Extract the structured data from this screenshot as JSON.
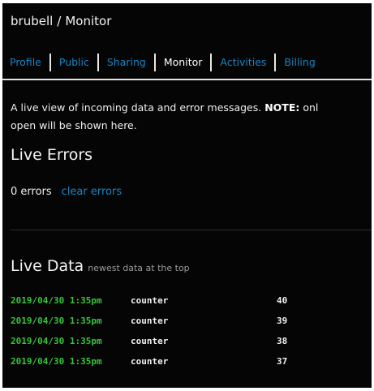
{
  "breadcrumb": {
    "user": "brubell",
    "separator": "/",
    "page": "Monitor"
  },
  "tabs": [
    {
      "label": "Profile",
      "active": false
    },
    {
      "label": "Public",
      "active": false
    },
    {
      "label": "Sharing",
      "active": false
    },
    {
      "label": "Monitor",
      "active": true
    },
    {
      "label": "Activities",
      "active": false
    },
    {
      "label": "Billing",
      "active": false
    }
  ],
  "description": {
    "text": "A live view of incoming data and error messages.",
    "note_label": "NOTE:",
    "note_text": "onl",
    "line2": "open will be shown here."
  },
  "errors": {
    "title": "Live Errors",
    "count_text": "0 errors",
    "clear_link": "clear errors"
  },
  "live_data": {
    "title": "Live Data",
    "subtitle": "newest data at the top",
    "rows": [
      {
        "timestamp": "2019/04/30 1:35pm",
        "feed": "counter",
        "value": "40"
      },
      {
        "timestamp": "2019/04/30 1:35pm",
        "feed": "counter",
        "value": "39"
      },
      {
        "timestamp": "2019/04/30 1:35pm",
        "feed": "counter",
        "value": "38"
      },
      {
        "timestamp": "2019/04/30 1:35pm",
        "feed": "counter",
        "value": "37"
      }
    ]
  },
  "colors": {
    "background": "#050505",
    "link": "#1a84c4",
    "timestamp": "#37c43a",
    "text": "#f0f0f0"
  }
}
